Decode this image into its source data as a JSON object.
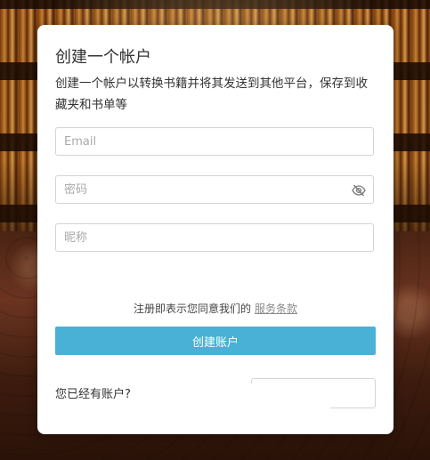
{
  "card": {
    "title": "创建一个帐户",
    "subtitle": "创建一个帐户以转换书籍并将其发送到其他平台，保存到收藏夹和书单等"
  },
  "form": {
    "email_placeholder": "Email",
    "password_placeholder": "密码",
    "nickname_placeholder": "昵称",
    "password_toggle_icon": "eye-slash-icon"
  },
  "terms": {
    "text": "注册即表示您同意我们的",
    "link_label": "服务条款"
  },
  "actions": {
    "submit_label": "创建账户",
    "have_account_text": "您已经有账户?",
    "login_label": ""
  },
  "colors": {
    "accent": "#48b1d5",
    "card_bg": "#ffffff",
    "border": "#d4d4d4"
  }
}
